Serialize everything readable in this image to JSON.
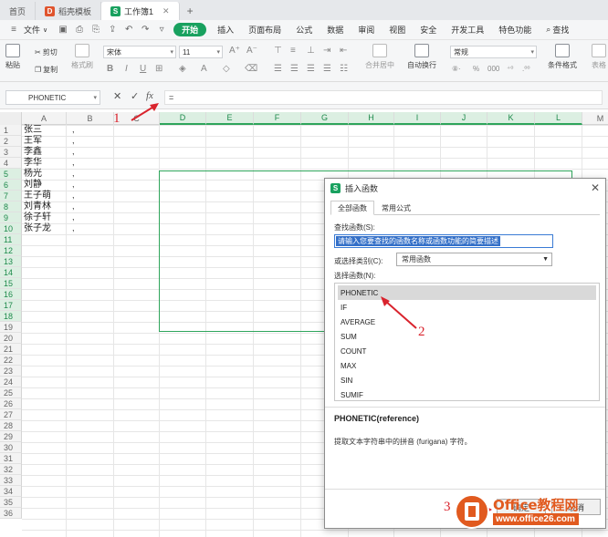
{
  "tabs": [
    {
      "label": "首页"
    },
    {
      "label": "稻壳模板"
    },
    {
      "label": "工作簿1"
    }
  ],
  "menu": {
    "file": "文件",
    "items": [
      "开始",
      "插入",
      "页面布局",
      "公式",
      "数据",
      "审阅",
      "视图",
      "安全",
      "开发工具",
      "特色功能"
    ],
    "search": "查找"
  },
  "ribbon": {
    "paste": "粘贴",
    "cut": "剪切",
    "copy": "复制",
    "format_painter": "格式刷",
    "font_name": "宋体",
    "font_size": "11",
    "merge_center": "合并居中",
    "wrap_text": "自动换行",
    "number_format": "常规",
    "conditional_format": "条件格式",
    "table_style": "表格"
  },
  "formula_bar": {
    "name_box": "PHONETIC",
    "formula": "="
  },
  "grid": {
    "columns": [
      "A",
      "B",
      "C",
      "D",
      "E",
      "F",
      "G",
      "H",
      "I",
      "J",
      "K",
      "L",
      "M"
    ],
    "rows": [
      "1",
      "2",
      "3",
      "4",
      "5",
      "6",
      "7",
      "8",
      "9",
      "10",
      "11",
      "12",
      "13",
      "14",
      "15",
      "16",
      "17",
      "18",
      "19",
      "20",
      "21",
      "22",
      "23",
      "24",
      "25",
      "26",
      "27",
      "28",
      "29",
      "30",
      "31",
      "32",
      "33",
      "34",
      "35",
      "36"
    ],
    "col_a": [
      "张三",
      "王军",
      "李鑫",
      "李华",
      "杨光",
      "刘静",
      "王子萌",
      "刘青林",
      "徐子轩",
      "张子龙"
    ],
    "col_b": [
      ",",
      ",",
      ",",
      ",",
      ",",
      ",",
      ",",
      ",",
      ",",
      ","
    ]
  },
  "dialog": {
    "title": "插入函数",
    "tabs": [
      "全部函数",
      "常用公式"
    ],
    "search_label": "查找函数(S):",
    "search_value": "请输入您要查找的函数名称或函数功能的简要描述",
    "category_label": "或选择类别(C):",
    "category_value": "常用函数",
    "list_label": "选择函数(N):",
    "functions": [
      "PHONETIC",
      "IF",
      "AVERAGE",
      "SUM",
      "COUNT",
      "MAX",
      "SIN",
      "SUMIF"
    ],
    "signature": "PHONETIC(reference)",
    "description": "提取文本字符串中的拼音 (furigana) 字符。",
    "ok": "确定",
    "cancel": "取消"
  },
  "annotations": [
    "1",
    "2",
    "3"
  ],
  "watermark": {
    "brand": "Office教程网",
    "url": "www.office26.com"
  },
  "colors": {
    "accent": "#19a15f",
    "annotation": "#d9232d",
    "brand": "#e15a1f"
  }
}
